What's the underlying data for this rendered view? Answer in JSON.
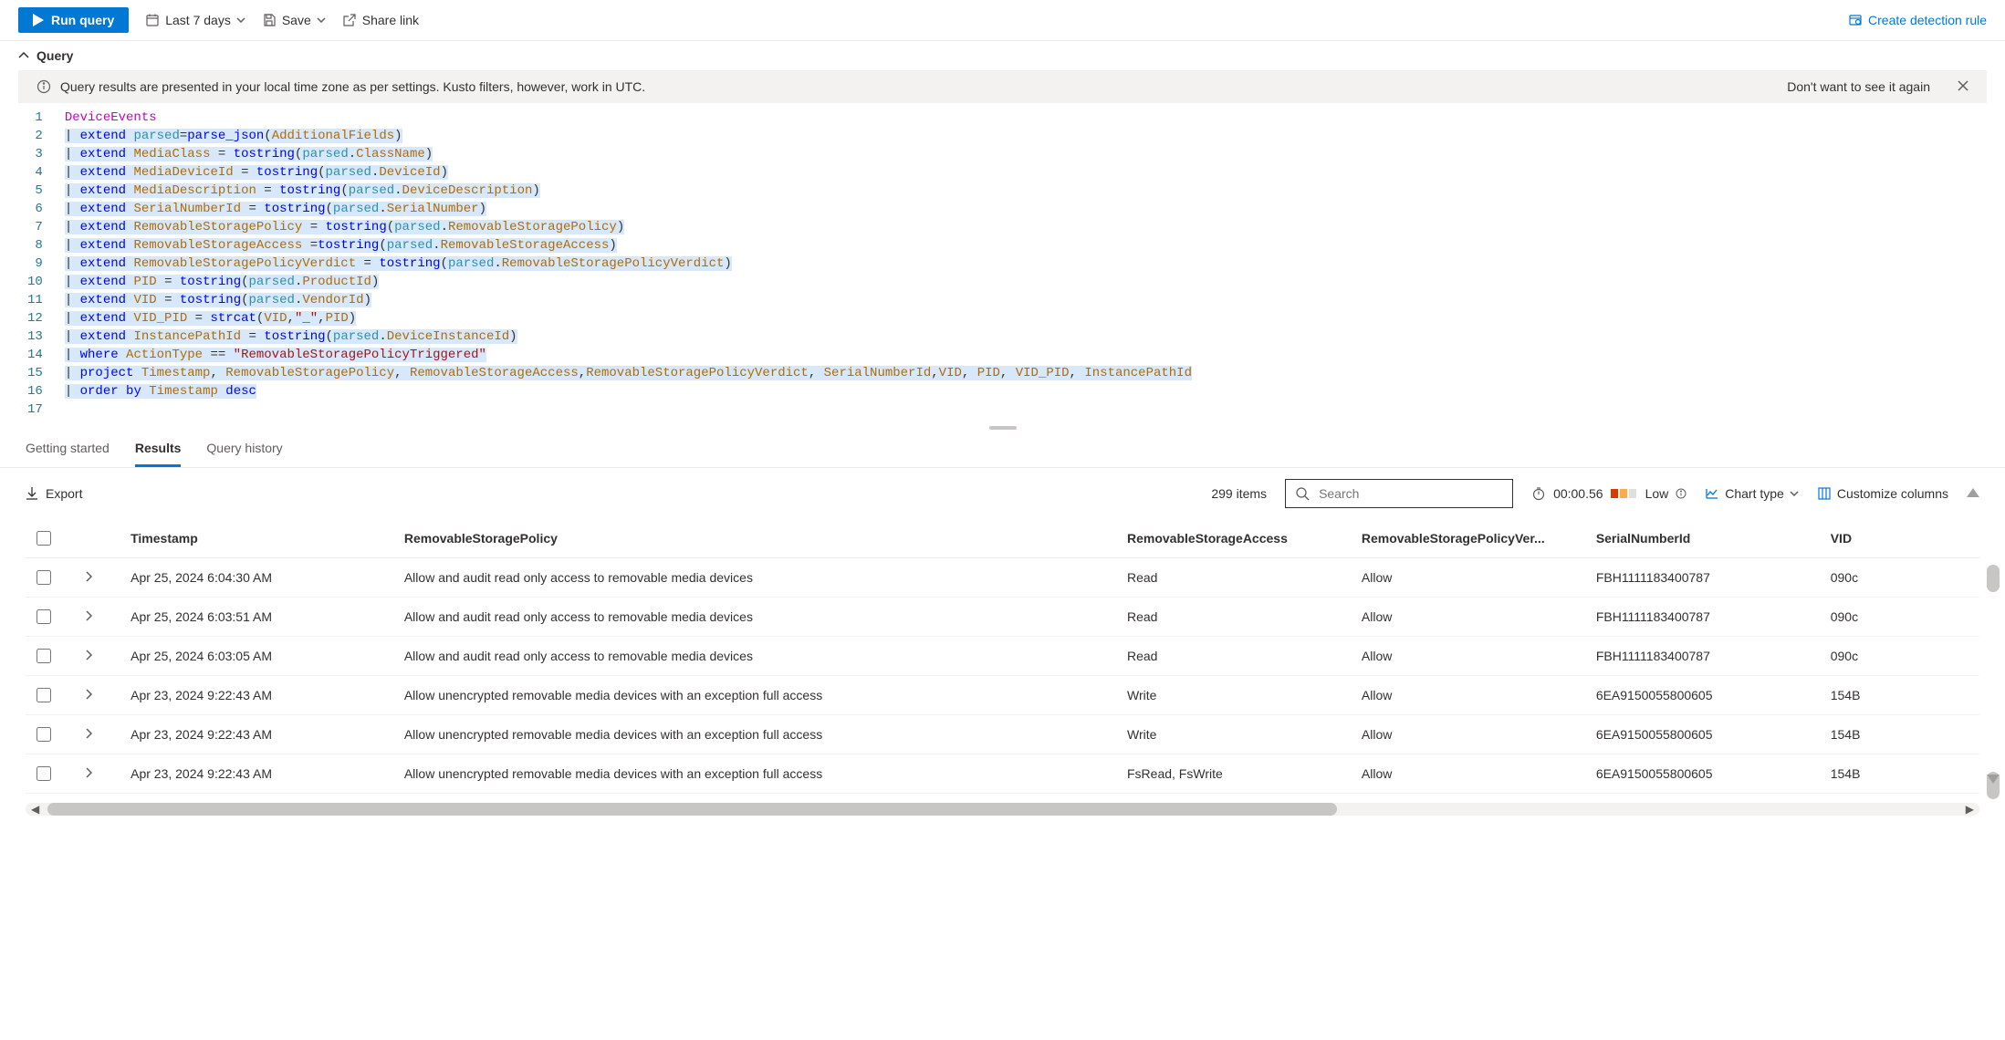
{
  "toolbar": {
    "run_label": "Run query",
    "time_label": "Last 7 days",
    "save_label": "Save",
    "share_label": "Share link",
    "detection_label": "Create detection rule"
  },
  "query_section": {
    "label": "Query"
  },
  "banner": {
    "message": "Query results are presented in your local time zone as per settings. Kusto filters, however, work in UTC.",
    "dismiss": "Don't want to see it again"
  },
  "editor": {
    "lines": [
      {
        "n": 1,
        "raw": "DeviceEvents"
      },
      {
        "n": 2,
        "raw": "| extend parsed=parse_json(AdditionalFields)"
      },
      {
        "n": 3,
        "raw": "| extend MediaClass = tostring(parsed.ClassName)"
      },
      {
        "n": 4,
        "raw": "| extend MediaDeviceId = tostring(parsed.DeviceId)"
      },
      {
        "n": 5,
        "raw": "| extend MediaDescription = tostring(parsed.DeviceDescription)"
      },
      {
        "n": 6,
        "raw": "| extend SerialNumberId = tostring(parsed.SerialNumber)"
      },
      {
        "n": 7,
        "raw": "| extend RemovableStoragePolicy = tostring(parsed.RemovableStoragePolicy)"
      },
      {
        "n": 8,
        "raw": "| extend RemovableStorageAccess =tostring(parsed.RemovableStorageAccess)"
      },
      {
        "n": 9,
        "raw": "| extend RemovableStoragePolicyVerdict = tostring(parsed.RemovableStoragePolicyVerdict)"
      },
      {
        "n": 10,
        "raw": "| extend PID = tostring(parsed.ProductId)"
      },
      {
        "n": 11,
        "raw": "| extend VID = tostring(parsed.VendorId)"
      },
      {
        "n": 12,
        "raw": "| extend VID_PID = strcat(VID,\"_\",PID)"
      },
      {
        "n": 13,
        "raw": "| extend InstancePathId = tostring(parsed.DeviceInstanceId)"
      },
      {
        "n": 14,
        "raw": "| where ActionType == \"RemovableStoragePolicyTriggered\""
      },
      {
        "n": 15,
        "raw": "| project Timestamp, RemovableStoragePolicy, RemovableStorageAccess,RemovableStoragePolicyVerdict, SerialNumberId,VID, PID, VID_PID, InstancePathId"
      },
      {
        "n": 16,
        "raw": "| order by Timestamp desc"
      },
      {
        "n": 17,
        "raw": ""
      }
    ]
  },
  "tabs": {
    "items": [
      "Getting started",
      "Results",
      "Query history"
    ],
    "active": 1
  },
  "results_bar": {
    "export_label": "Export",
    "count_label": "299 items",
    "search_placeholder": "Search",
    "elapsed": "00:00.56",
    "perf_label": "Low",
    "chart_label": "Chart type",
    "customize_label": "Customize columns"
  },
  "table": {
    "columns": [
      "Timestamp",
      "RemovableStoragePolicy",
      "RemovableStorageAccess",
      "RemovableStoragePolicyVer...",
      "SerialNumberId",
      "VID"
    ],
    "rows": [
      {
        "ts": "Apr 25, 2024 6:04:30 AM",
        "pol": "Allow and audit read only access to removable media devices",
        "acc": "Read",
        "ver": "Allow",
        "ser": "FBH1111183400787",
        "vid": "090c"
      },
      {
        "ts": "Apr 25, 2024 6:03:51 AM",
        "pol": "Allow and audit read only access to removable media devices",
        "acc": "Read",
        "ver": "Allow",
        "ser": "FBH1111183400787",
        "vid": "090c"
      },
      {
        "ts": "Apr 25, 2024 6:03:05 AM",
        "pol": "Allow and audit read only access to removable media devices",
        "acc": "Read",
        "ver": "Allow",
        "ser": "FBH1111183400787",
        "vid": "090c"
      },
      {
        "ts": "Apr 23, 2024 9:22:43 AM",
        "pol": "Allow unencrypted removable media devices with an exception full access",
        "acc": "Write",
        "ver": "Allow",
        "ser": "6EA9150055800605",
        "vid": "154B"
      },
      {
        "ts": "Apr 23, 2024 9:22:43 AM",
        "pol": "Allow unencrypted removable media devices with an exception full access",
        "acc": "Write",
        "ver": "Allow",
        "ser": "6EA9150055800605",
        "vid": "154B"
      },
      {
        "ts": "Apr 23, 2024 9:22:43 AM",
        "pol": "Allow unencrypted removable media devices with an exception full access",
        "acc": "FsRead, FsWrite",
        "ver": "Allow",
        "ser": "6EA9150055800605",
        "vid": "154B"
      }
    ]
  }
}
